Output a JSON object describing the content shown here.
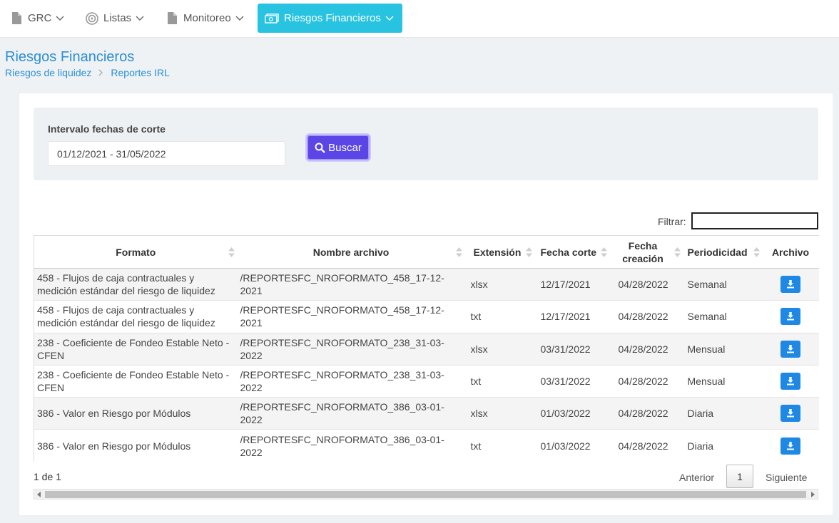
{
  "nav": {
    "items": [
      {
        "label": "GRC",
        "icon": "file-icon"
      },
      {
        "label": "Listas",
        "icon": "target-icon"
      },
      {
        "label": "Monitoreo",
        "icon": "file-icon"
      },
      {
        "label": "Riesgos Financieros",
        "icon": "money-icon",
        "active": true
      }
    ]
  },
  "header": {
    "title": "Riesgos Financieros",
    "breadcrumb": [
      "Riesgos de liquidez",
      "Reportes IRL"
    ]
  },
  "filters": {
    "label": "Intervalo fechas de corte",
    "date_range_value": "01/12/2021 - 31/05/2022",
    "search_button": "Buscar"
  },
  "table": {
    "filter_label": "Filtrar:",
    "filter_value": "",
    "columns": [
      "Formato",
      "Nombre archivo",
      "Extensión",
      "Fecha corte",
      "Fecha creación",
      "Periodicidad",
      "Archivo"
    ],
    "rows": [
      {
        "formato": "458 - Flujos de caja contractuales y medición estándar del riesgo de liquidez",
        "nombre": "/REPORTESFC_NROFORMATO_458_17-12-2021",
        "extension": "xlsx",
        "fecha_corte": "12/17/2021",
        "fecha_creacion": "04/28/2022",
        "periodicidad": "Semanal"
      },
      {
        "formato": "458 - Flujos de caja contractuales y medición estándar del riesgo de liquidez",
        "nombre": "/REPORTESFC_NROFORMATO_458_17-12-2021",
        "extension": "txt",
        "fecha_corte": "12/17/2021",
        "fecha_creacion": "04/28/2022",
        "periodicidad": "Semanal"
      },
      {
        "formato": "238 - Coeficiente de Fondeo Estable Neto - CFEN",
        "nombre": "/REPORTESFC_NROFORMATO_238_31-03-2022",
        "extension": "xlsx",
        "fecha_corte": "03/31/2022",
        "fecha_creacion": "04/28/2022",
        "periodicidad": "Mensual"
      },
      {
        "formato": "238 - Coeficiente de Fondeo Estable Neto - CFEN",
        "nombre": "/REPORTESFC_NROFORMATO_238_31-03-2022",
        "extension": "txt",
        "fecha_corte": "03/31/2022",
        "fecha_creacion": "04/28/2022",
        "periodicidad": "Mensual"
      },
      {
        "formato": "386 - Valor en Riesgo por Módulos",
        "nombre": "/REPORTESFC_NROFORMATO_386_03-01-2022",
        "extension": "xlsx",
        "fecha_corte": "01/03/2022",
        "fecha_creacion": "04/28/2022",
        "periodicidad": "Diaria"
      },
      {
        "formato": "386 - Valor en Riesgo por Módulos",
        "nombre": "/REPORTESFC_NROFORMATO_386_03-01-2022",
        "extension": "txt",
        "fecha_corte": "01/03/2022",
        "fecha_creacion": "04/28/2022",
        "periodicidad": "Diaria"
      }
    ],
    "info": "1 de 1",
    "pagination": {
      "prev": "Anterior",
      "page": "1",
      "next": "Siguiente"
    }
  },
  "colors": {
    "accent": "#27c3e0",
    "primary_button": "#5b45e6",
    "download_button": "#1e88e5",
    "title": "#2b8fd6"
  }
}
